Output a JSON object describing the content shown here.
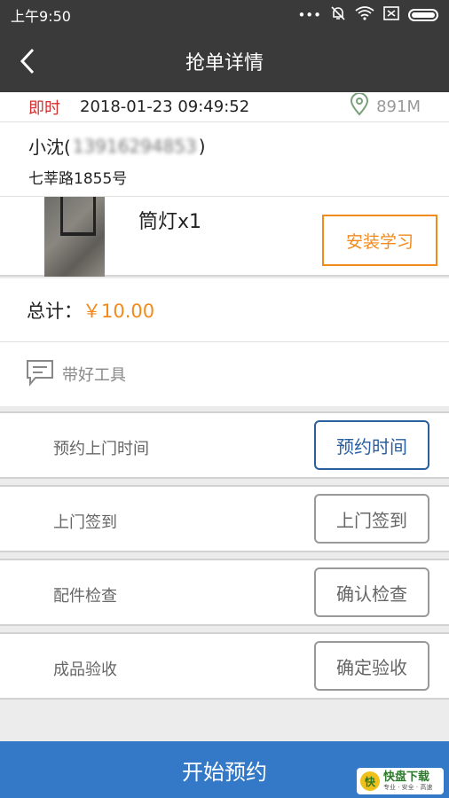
{
  "status_bar": {
    "time": "上午9:50",
    "icons": [
      "dots-icon",
      "mute-bell-icon",
      "wifi-icon",
      "sim-icon",
      "battery-icon"
    ]
  },
  "nav": {
    "title": "抢单详情",
    "back_icon": "chevron-left-icon"
  },
  "order": {
    "type_tag": "即时",
    "datetime": "2018-01-23 09:49:52",
    "distance": "891M",
    "customer_name_prefix": "小沈(",
    "customer_phone": "13916294853",
    "customer_name_suffix": ")",
    "address": "七莘路1855号"
  },
  "product": {
    "name": "筒灯x1",
    "install_label": "安装学习"
  },
  "total": {
    "label": "总计：",
    "value": "￥10.00"
  },
  "note": {
    "text": "带好工具",
    "icon": "message-icon"
  },
  "steps": [
    {
      "label": "预约上门时间",
      "button": "预约时间",
      "active": true
    },
    {
      "label": "上门签到",
      "button": "上门签到",
      "active": false
    },
    {
      "label": "配件检查",
      "button": "确认检查",
      "active": false
    },
    {
      "label": "成品验收",
      "button": "确定验收",
      "active": false
    }
  ],
  "bottom": {
    "label": "开始预约"
  },
  "watermark": {
    "char": "快",
    "title": "快盘下载",
    "sub": "专业 · 安全 · 高速"
  },
  "colors": {
    "orange": "#f28a1e",
    "blue_bar": "#3479c7",
    "active_blue": "#2a5f9e",
    "red_tag": "#d32f2f",
    "dark_header": "#3a3a3a"
  }
}
